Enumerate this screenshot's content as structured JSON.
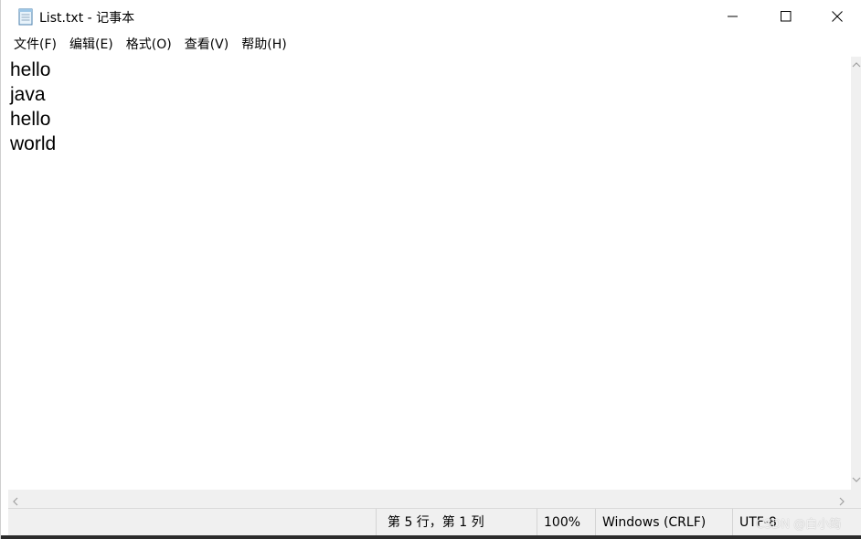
{
  "window": {
    "title": "List.txt - 记事本",
    "icon": "notepad-icon"
  },
  "controls": {
    "minimize": "minimize-icon",
    "maximize": "maximize-icon",
    "close": "close-icon"
  },
  "menu": {
    "items": [
      "文件(F)",
      "编辑(E)",
      "格式(O)",
      "查看(V)",
      "帮助(H)"
    ]
  },
  "editor": {
    "lines": [
      "hello",
      "java",
      "hello",
      "world"
    ]
  },
  "status": {
    "position": "第 5 行，第 1 列",
    "zoom": "100%",
    "line_ending": "Windows (CRLF)",
    "encoding": "UTF-8"
  },
  "watermark": "CSDN @白小筠"
}
